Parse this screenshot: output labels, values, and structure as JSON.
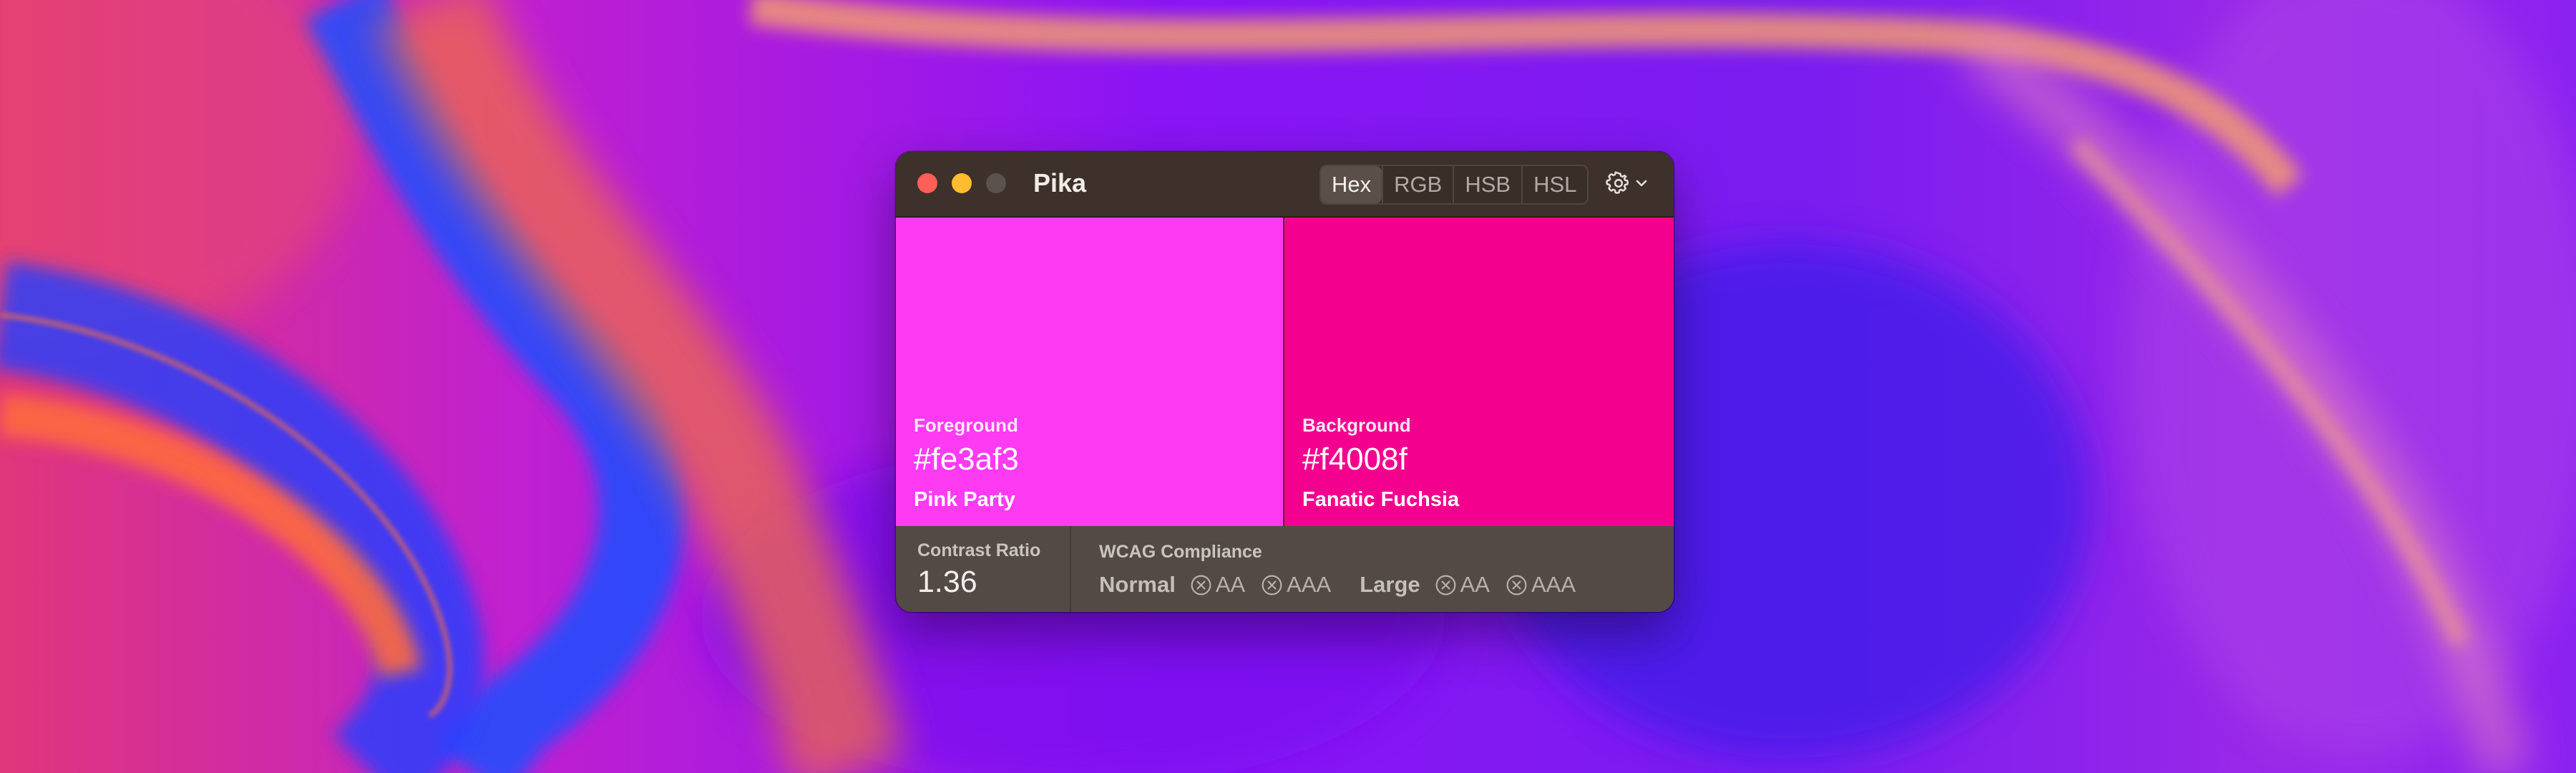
{
  "window": {
    "title": "Pika",
    "format_tabs": [
      {
        "label": "Hex",
        "active": true
      },
      {
        "label": "RGB",
        "active": false
      },
      {
        "label": "HSB",
        "active": false
      },
      {
        "label": "HSL",
        "active": false
      }
    ],
    "settings_icon": "gear-icon",
    "settings_chevron_icon": "chevron-down-icon"
  },
  "foreground": {
    "label": "Foreground",
    "hex": "#fe3af3",
    "name": "Pink Party",
    "color": "#fe3af3"
  },
  "background": {
    "label": "Background",
    "hex": "#f4008f",
    "name": "Fanatic Fuchsia",
    "color": "#f4008f"
  },
  "contrast": {
    "label": "Contrast Ratio",
    "value": "1.36"
  },
  "wcag": {
    "label": "WCAG Compliance",
    "normal": {
      "label": "Normal",
      "aa": {
        "label": "AA",
        "pass": false,
        "icon": "x-circle-icon"
      },
      "aaa": {
        "label": "AAA",
        "pass": false,
        "icon": "x-circle-icon"
      }
    },
    "large": {
      "label": "Large",
      "aa": {
        "label": "AA",
        "pass": false,
        "icon": "x-circle-icon"
      },
      "aaa": {
        "label": "AAA",
        "pass": false,
        "icon": "x-circle-icon"
      }
    }
  },
  "colors": {
    "close": "#fe5f57",
    "minimize": "#febc2e",
    "zoom_disabled": "#5c524d",
    "titlebar": "#3e302a",
    "footer": "#534a45"
  }
}
